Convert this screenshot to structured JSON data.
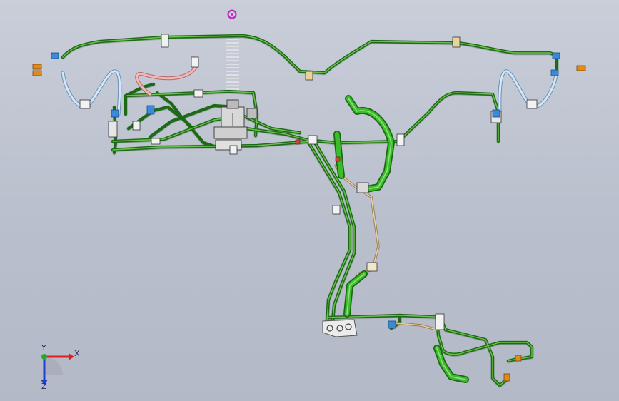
{
  "viewport": {
    "background_top": "#c9ced9",
    "background_bottom": "#b3b9c6"
  },
  "colors": {
    "tube_green": "#2f8a1e",
    "tube_green_light": "#6cc24a",
    "hose_bright_green": "#38b52a",
    "hose_blue": "#b8d6ee",
    "hose_pink": "#e8a0a0",
    "tan_line": "#d9b98a",
    "clip_white": "#f2f2f2",
    "fitting_orange": "#e08a20",
    "fitting_blue": "#3a8ad8",
    "marker_magenta": "#c020c0"
  },
  "icons": {
    "top_marker": "origin-target-icon",
    "axis_triad": "coordinate-triad-icon"
  },
  "triad": {
    "x_label": "X",
    "y_label": "Y",
    "z_label": "Z"
  }
}
